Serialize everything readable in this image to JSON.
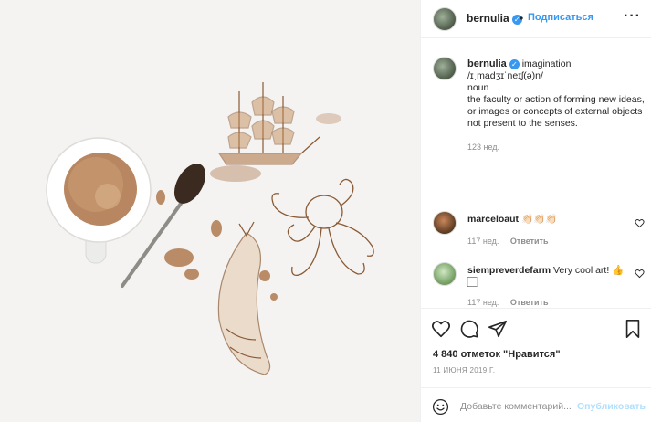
{
  "header": {
    "username": "bernulia",
    "verified_mark": "✓",
    "dot": "•",
    "follow_label": "Подписаться",
    "more_label": "···"
  },
  "caption": {
    "username": "bernulia",
    "verified_mark": "✓",
    "title": "imagination",
    "pronunciation": "/ɪˌmadʒɪˈneɪʃ(ə)n/",
    "part_of_speech": "noun",
    "definition": "the faculty or action of forming new ideas, or images or concepts of external objects not present to the senses.",
    "time": "123 нед."
  },
  "comments": [
    {
      "username": "marceloaut",
      "text": "👏🏻👏🏻👏🏻",
      "time": "117 нед.",
      "reply_label": "Ответить"
    },
    {
      "username": "siempreverdefarm",
      "text": "Very cool art! 👍 🏻",
      "time": "117 нед.",
      "reply_label": "Ответить"
    }
  ],
  "actions": {
    "like_icon": "heart-icon",
    "comment_icon": "comment-icon",
    "share_icon": "share-icon",
    "save_icon": "bookmark-icon"
  },
  "likes": "4 840 отметок \"Нравится\"",
  "date": "11 ИЮНЯ 2019 Г.",
  "add_comment": {
    "placeholder": "Добавьте комментарий...",
    "publish_label": "Опубликовать"
  },
  "colors": {
    "accent": "#3897f0",
    "publish_disabled": "#b2dffc",
    "muted": "#8e8e8e",
    "coffee": "#8a5a34"
  }
}
